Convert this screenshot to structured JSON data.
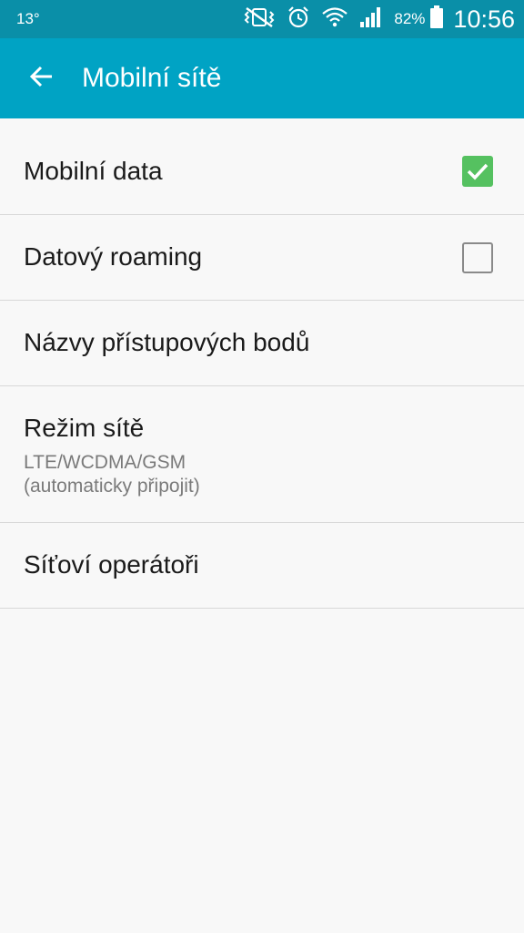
{
  "status_bar": {
    "temperature": "13°",
    "battery_percent": "82%",
    "time": "10:56",
    "icons": [
      "vibrate-mute-icon",
      "alarm-icon",
      "wifi-icon",
      "signal-icon",
      "battery-icon"
    ]
  },
  "app_bar": {
    "title": "Mobilní sítě",
    "back_icon": "arrow-back-icon"
  },
  "settings": {
    "mobile_data": {
      "label": "Mobilní data",
      "checked": true
    },
    "data_roaming": {
      "label": "Datový roaming",
      "checked": false
    },
    "apn": {
      "label": "Názvy přístupových bodů"
    },
    "network_mode": {
      "label": "Režim sítě",
      "summary_line1": "LTE/WCDMA/GSM",
      "summary_line2": "(automaticky připojit)"
    },
    "operators": {
      "label": "Síťoví operátoři"
    }
  },
  "colors": {
    "status_bar": "#0a8fa8",
    "app_bar": "#00a3c4",
    "checkbox_checked": "#55c160",
    "background": "#f8f8f8"
  }
}
